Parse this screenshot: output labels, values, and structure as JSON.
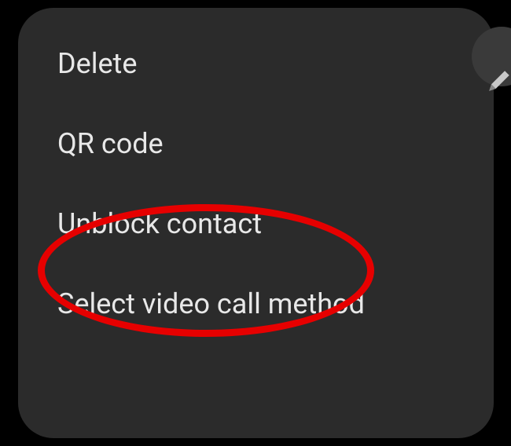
{
  "menu": {
    "items": [
      {
        "label": "Delete"
      },
      {
        "label": "QR code"
      },
      {
        "label": "Unblock contact"
      },
      {
        "label": "Select video call method"
      }
    ]
  },
  "highlightColor": "#e60000",
  "panelBackground": "#2b2b2b"
}
